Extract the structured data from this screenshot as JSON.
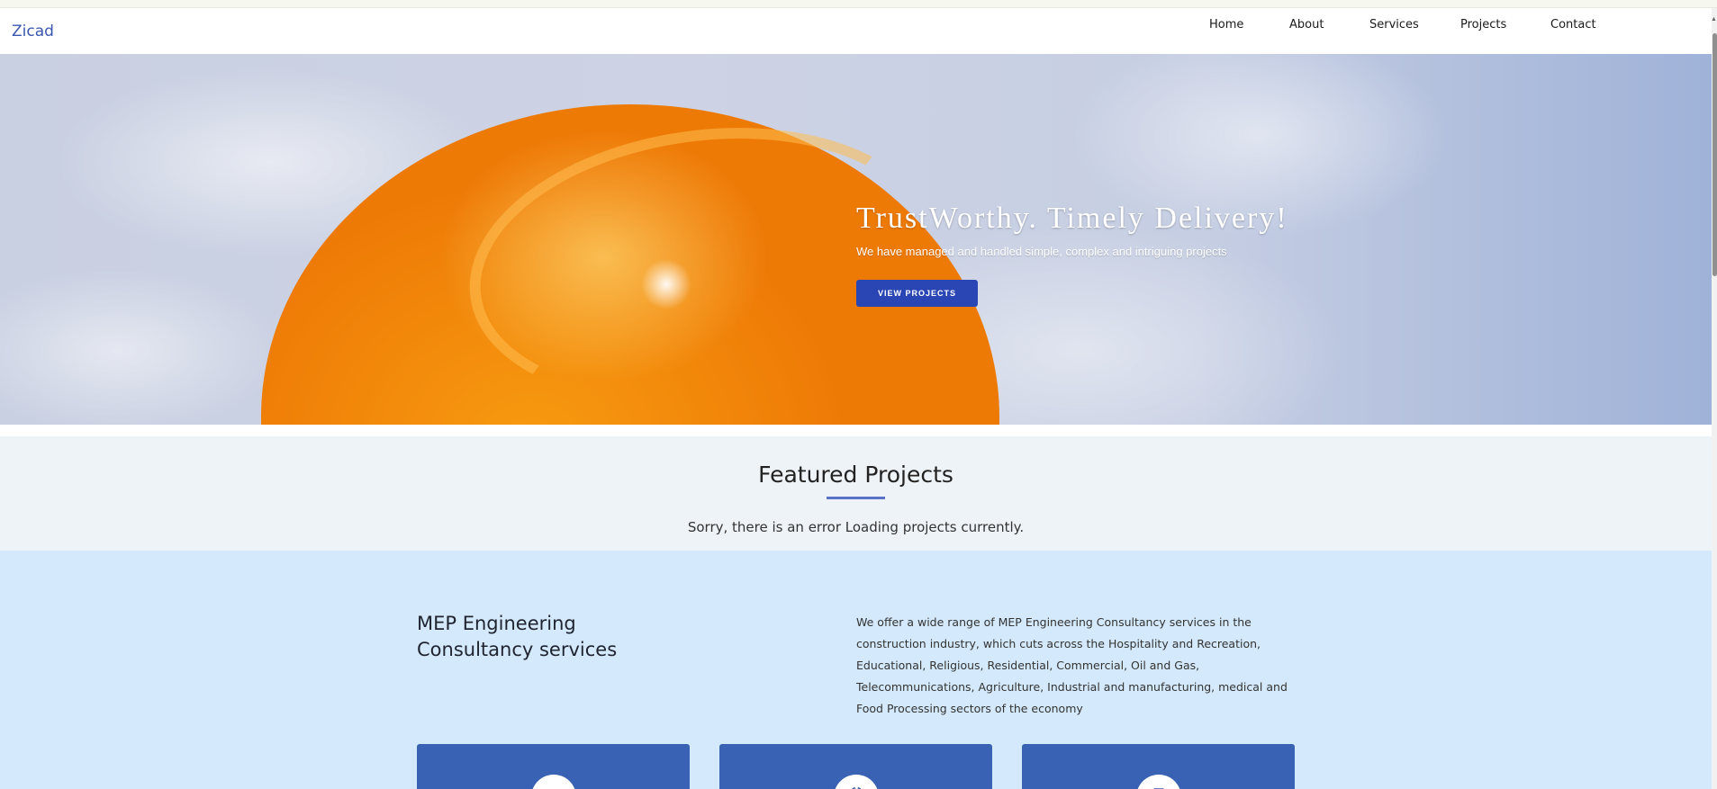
{
  "brand": "Zicad",
  "nav": {
    "items": [
      {
        "label": "Home"
      },
      {
        "label": "About"
      },
      {
        "label": "Services"
      },
      {
        "label": "Projects"
      },
      {
        "label": "Contact"
      }
    ]
  },
  "hero": {
    "title": "TrustWorthy. Timely Delivery!",
    "subtitle": "We have managed and handled simple, complex and intriguing projects",
    "button_label": "VIEW PROJECTS"
  },
  "featured": {
    "title": "Featured Projects",
    "message": "Sorry, there is an error Loading projects currently."
  },
  "services": {
    "heading": "MEP Engineering Consultancy services",
    "description": "We offer a wide range of MEP Engineering Consultancy services in the construction industry, which cuts across the Hospitality and Recreation, Educational, Religious, Residential, Commercial, Oil and Gas, Telecommunications, Agriculture, Industrial and manufacturing, medical and Food Processing sectors of the economy",
    "cards": [
      {
        "icon": "building-icon",
        "glyph": "⌂"
      },
      {
        "icon": "tools-icon",
        "glyph": "⚒"
      },
      {
        "icon": "blueprint-icon",
        "glyph": "▤"
      }
    ]
  },
  "colors": {
    "brand": "#3a56b0",
    "hero_button": "#2a46b4",
    "service_card": "#3a62b4",
    "services_bg": "#d4e9fb"
  }
}
